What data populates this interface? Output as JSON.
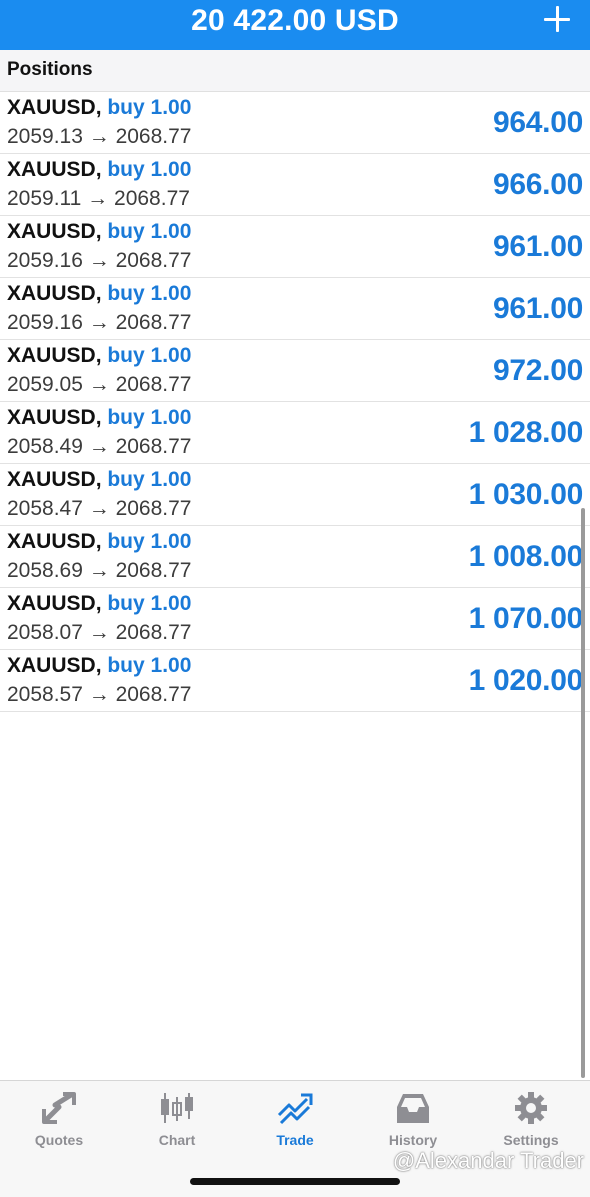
{
  "header": {
    "balance": "20 422.00 USD",
    "add_icon": "plus-icon"
  },
  "section": {
    "title": "Positions"
  },
  "positions": [
    {
      "symbol": "XAUUSD",
      "type": "buy 1.00",
      "prices": "2059.13 → 2068.77",
      "profit": "964.00"
    },
    {
      "symbol": "XAUUSD",
      "type": "buy 1.00",
      "prices": "2059.11 → 2068.77",
      "profit": "966.00"
    },
    {
      "symbol": "XAUUSD",
      "type": "buy 1.00",
      "prices": "2059.16 → 2068.77",
      "profit": "961.00"
    },
    {
      "symbol": "XAUUSD",
      "type": "buy 1.00",
      "prices": "2059.16 → 2068.77",
      "profit": "961.00"
    },
    {
      "symbol": "XAUUSD",
      "type": "buy 1.00",
      "prices": "2059.05 → 2068.77",
      "profit": "972.00"
    },
    {
      "symbol": "XAUUSD",
      "type": "buy 1.00",
      "prices": "2058.49 → 2068.77",
      "profit": "1 028.00"
    },
    {
      "symbol": "XAUUSD",
      "type": "buy 1.00",
      "prices": "2058.47 → 2068.77",
      "profit": "1 030.00"
    },
    {
      "symbol": "XAUUSD",
      "type": "buy 1.00",
      "prices": "2058.69 → 2068.77",
      "profit": "1 008.00"
    },
    {
      "symbol": "XAUUSD",
      "type": "buy 1.00",
      "prices": "2058.07 → 2068.77",
      "profit": "1 070.00"
    },
    {
      "symbol": "XAUUSD",
      "type": "buy 1.00",
      "prices": "2058.57 → 2068.77",
      "profit": "1 020.00"
    }
  ],
  "tabs": [
    {
      "label": "Quotes",
      "icon": "quotes-arrows-icon",
      "active": false
    },
    {
      "label": "Chart",
      "icon": "candlestick-chart-icon",
      "active": false
    },
    {
      "label": "Trade",
      "icon": "trade-trend-icon",
      "active": true
    },
    {
      "label": "History",
      "icon": "history-inbox-icon",
      "active": false
    },
    {
      "label": "Settings",
      "icon": "gear-icon",
      "active": false
    }
  ],
  "watermark": "@Alexandar Trader",
  "colors": {
    "accent": "#1a8cf0",
    "profit": "#1a7ad8",
    "inactive": "#8e8e93"
  }
}
